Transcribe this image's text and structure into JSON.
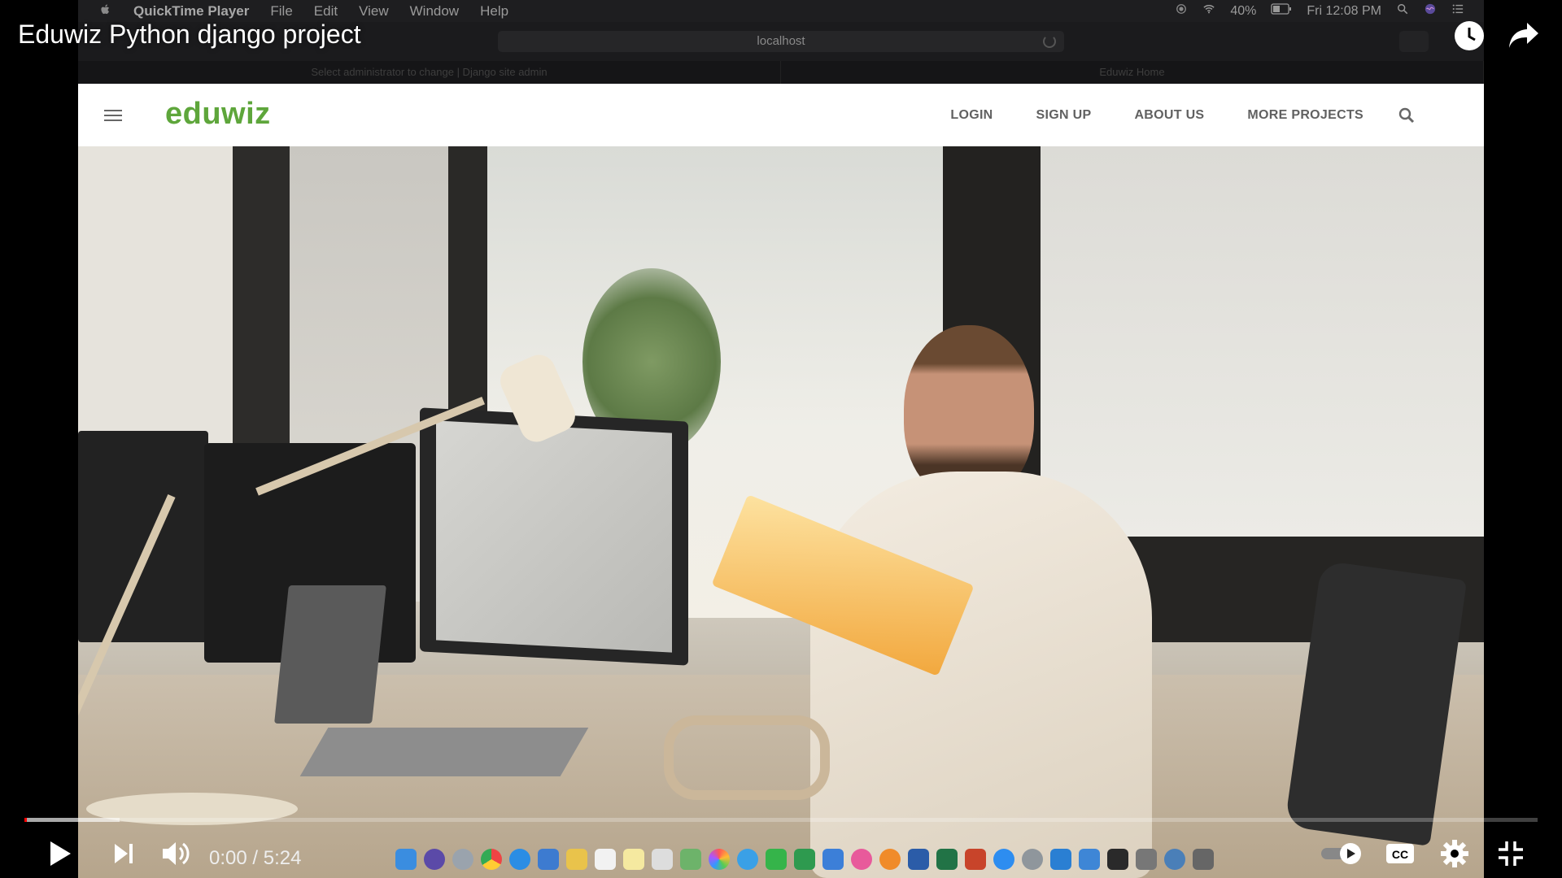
{
  "window": {
    "title": "Eduwiz Python django project"
  },
  "mac_menubar": {
    "app_name": "QuickTime Player",
    "menus": [
      "File",
      "Edit",
      "View",
      "Window",
      "Help"
    ],
    "battery": "40%",
    "clock": "Fri 12:08 PM"
  },
  "browser": {
    "url": "localhost",
    "tabs": [
      "Select administrator to change | Django site admin",
      "Eduwiz Home"
    ]
  },
  "site": {
    "logo": "eduwiz",
    "nav": [
      "LOGIN",
      "SIGN UP",
      "ABOUT US",
      "MORE PROJECTS"
    ],
    "colors": {
      "brand": "#5ea63b",
      "nav_text": "#616161"
    }
  },
  "player": {
    "current_time": "0:00",
    "separator": "/",
    "duration": "5:24",
    "progress_fraction": 0.0,
    "buffered_fraction": 0.063,
    "colors": {
      "played": "#ff0000"
    }
  },
  "icons": {
    "top_right": [
      "watch-later-icon",
      "share-icon"
    ],
    "controls_left": [
      "play-icon",
      "next-icon",
      "volume-icon"
    ],
    "controls_right": [
      "autoplay-toggle-icon",
      "captions-icon",
      "settings-icon",
      "exit-fullscreen-icon"
    ]
  }
}
